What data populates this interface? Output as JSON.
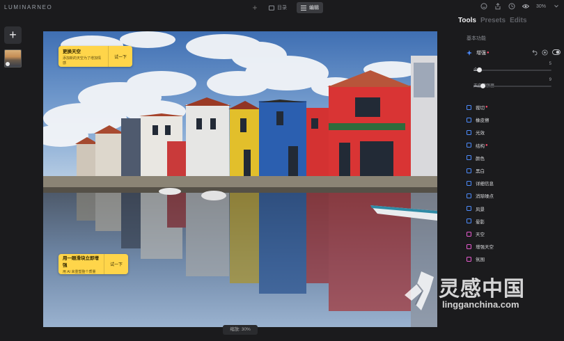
{
  "app": {
    "logo": "LUMINARNEO"
  },
  "topbar": {
    "tabs": [
      {
        "label": "目录",
        "active": false
      },
      {
        "label": "编辑",
        "active": true
      }
    ],
    "zoom": "30%"
  },
  "canvas": {
    "zoom_label": "缩放: 30%"
  },
  "cards": [
    {
      "title": "更换天空",
      "desc": "添加新的天空为了增加情感",
      "button": "试一下"
    },
    {
      "title": "用一眼滑块立即增强",
      "desc": "用 AI 来重塑整个质量",
      "button": "试一下"
    }
  ],
  "panel": {
    "tabs": [
      {
        "label": "Tools",
        "active": true
      },
      {
        "label": "Presets",
        "active": false
      },
      {
        "label": "Edits",
        "active": false
      }
    ],
    "section_title": "基本功能",
    "enhance": {
      "label": "增强",
      "sliders": [
        {
          "label": "个性",
          "value": "5",
          "fraction": 0.05
        },
        {
          "label": "天空增强器",
          "value": "9",
          "fraction": 0.09
        }
      ]
    },
    "tools": [
      {
        "label": "裁切",
        "icon": "crop-icon",
        "color": "#4d8cff",
        "modified": true
      },
      {
        "label": "橡皮擦",
        "icon": "eraser-icon",
        "color": "#4d8cff",
        "modified": false
      },
      {
        "label": "光效",
        "icon": "light-icon",
        "color": "#4d8cff",
        "modified": false
      },
      {
        "label": "结构",
        "icon": "structure-icon",
        "color": "#4d8cff",
        "modified": true
      },
      {
        "label": "颜色",
        "icon": "color-icon",
        "color": "#4d8cff",
        "modified": false
      },
      {
        "label": "黑白",
        "icon": "bw-icon",
        "color": "#4d8cff",
        "modified": false
      },
      {
        "label": "详细信息",
        "icon": "details-icon",
        "color": "#4d8cff",
        "modified": false
      },
      {
        "label": "消除噪点",
        "icon": "denoise-icon",
        "color": "#4d8cff",
        "modified": false
      },
      {
        "label": "风景",
        "icon": "landscape-icon",
        "color": "#4d8cff",
        "modified": false
      },
      {
        "label": "晕影",
        "icon": "vignette-icon",
        "color": "#4d8cff",
        "modified": false
      },
      {
        "label": "天空",
        "icon": "sky-icon",
        "color": "#e85bd0",
        "modified": false
      },
      {
        "label": "增强天空",
        "icon": "sky-enhance-icon",
        "color": "#e85bd0",
        "modified": false
      },
      {
        "label": "氛围",
        "icon": "atmosphere-icon",
        "color": "#e85bd0",
        "modified": false
      }
    ]
  },
  "watermark": {
    "cn": "灵感中国",
    "en": "lingganchina.com"
  }
}
